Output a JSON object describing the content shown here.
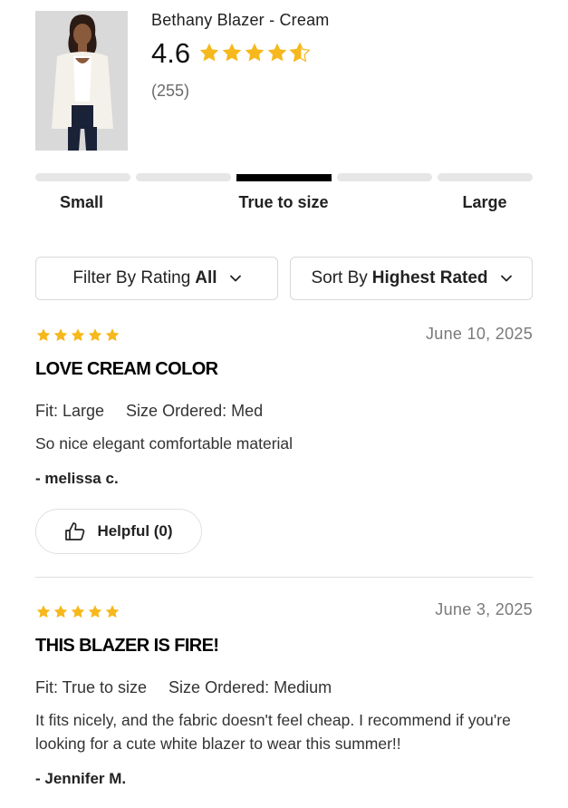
{
  "product": {
    "title": "Bethany Blazer - Cream",
    "rating": "4.6",
    "review_count": "(255)",
    "image_icon": "model-wearing-cream-blazer-photo"
  },
  "fit_scale": {
    "labels": [
      "Small",
      "True to size",
      "Large"
    ],
    "segment_count": 5,
    "active_segment": 3
  },
  "filters": {
    "rating_label": "Filter By Rating",
    "rating_value": "All",
    "sort_label": "Sort By",
    "sort_value": "Highest Rated"
  },
  "colors": {
    "star": "#f6b81c",
    "active_bar": "#000000",
    "inactive_bar": "#e6e6e6"
  },
  "reviews": [
    {
      "stars": 5,
      "date": "June 10, 2025",
      "title": "LOVE CREAM COLOR",
      "fit": "Fit: Large",
      "size_ordered": "Size Ordered: Med",
      "body": "So nice elegant comfortable material",
      "author": "- melissa c.",
      "helpful": "Helpful (0)"
    },
    {
      "stars": 5,
      "date": "June 3, 2025",
      "title": "THIS BLAZER IS FIRE!",
      "fit": "Fit: True to size",
      "size_ordered": "Size Ordered: Medium",
      "body": "It fits nicely, and the fabric doesn't feel cheap. I recommend if you're looking for a cute white blazer to wear this summer!!",
      "author": "- Jennifer M."
    }
  ]
}
